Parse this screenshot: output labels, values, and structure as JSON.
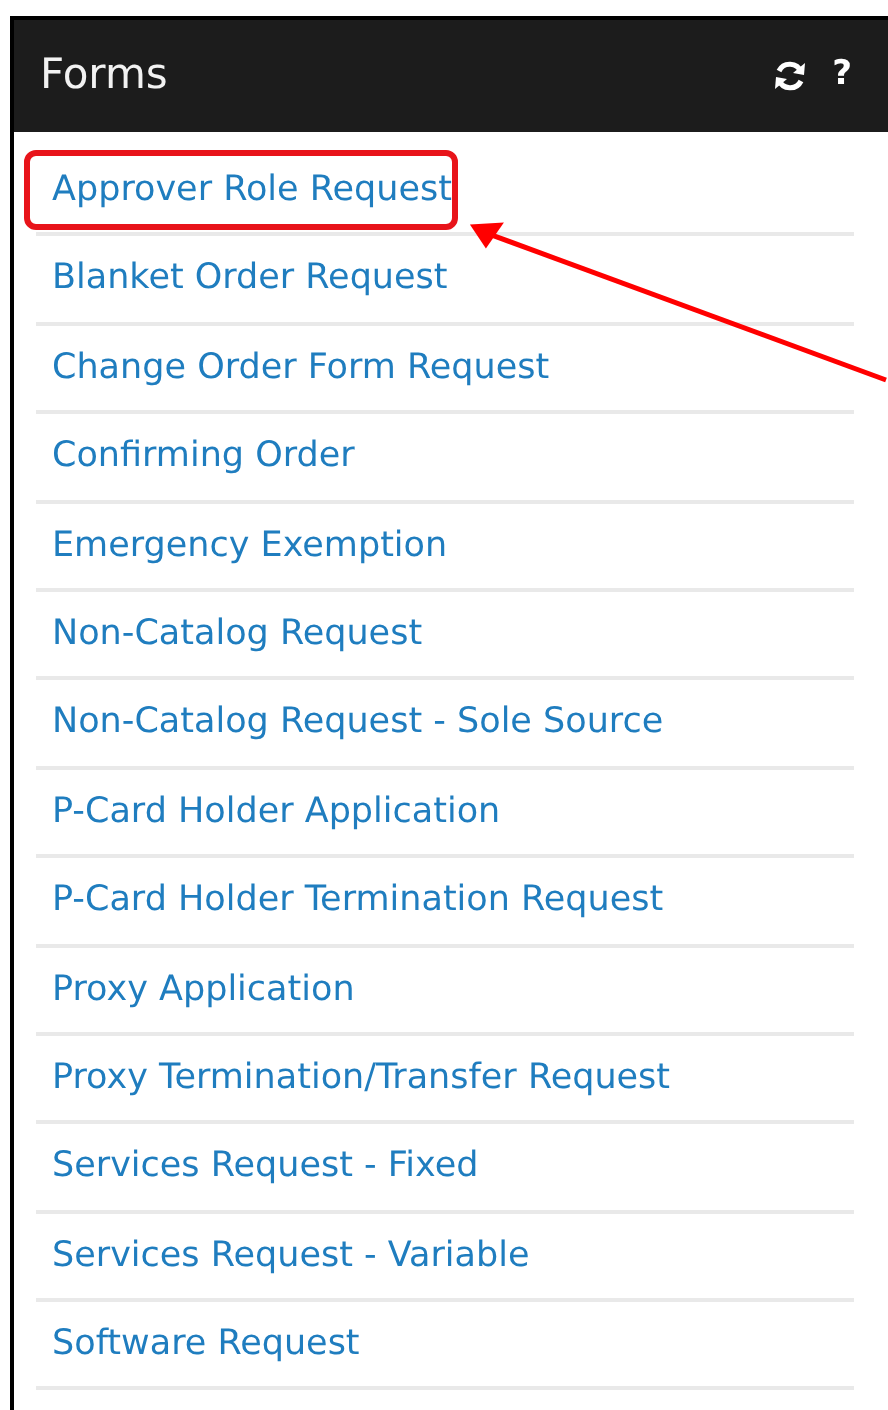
{
  "panel": {
    "title": "Forms",
    "toolbar": [
      "?"
    ],
    "items": [
      {
        "label": "Approver Role Request",
        "highlighted": true
      },
      {
        "label": "Blanket Order Request",
        "highlighted": false
      },
      {
        "label": "Change Order Form Request",
        "highlighted": false
      },
      {
        "label": "Confirming Order",
        "highlighted": false
      },
      {
        "label": "Emergency Exemption",
        "highlighted": false
      },
      {
        "label": "Non-Catalog Request",
        "highlighted": false
      },
      {
        "label": "Non-Catalog Request - Sole Source",
        "highlighted": false
      },
      {
        "label": "P-Card Holder Application",
        "highlighted": false
      },
      {
        "label": "P-Card Holder Termination Request",
        "highlighted": false
      },
      {
        "label": "Proxy Application",
        "highlighted": false
      },
      {
        "label": "Proxy Termination/Transfer Request",
        "highlighted": false
      },
      {
        "label": "Services Request - Fixed",
        "highlighted": false
      },
      {
        "label": "Services Request - Variable",
        "highlighted": false
      },
      {
        "label": "Software Request",
        "highlighted": false
      }
    ]
  }
}
